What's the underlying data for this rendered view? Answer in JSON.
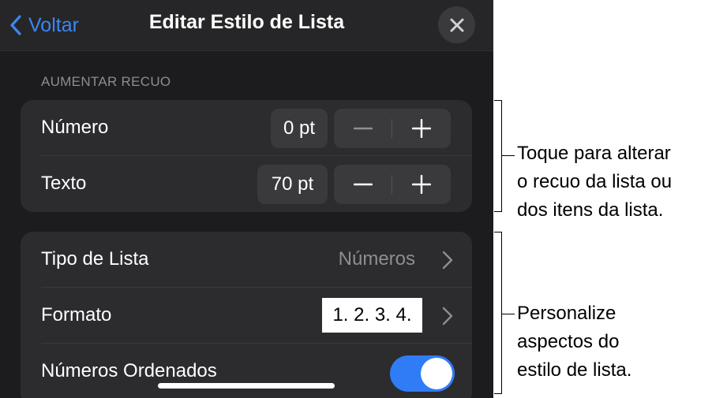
{
  "navbar": {
    "back_label": "Voltar",
    "title": "Editar Estilo de Lista"
  },
  "indent_section": {
    "header": "AUMENTAR RECUO",
    "rows": [
      {
        "label": "Número",
        "value": "0 pt"
      },
      {
        "label": "Texto",
        "value": "70 pt"
      }
    ]
  },
  "list_section": {
    "list_type": {
      "label": "Tipo de Lista",
      "value": "Números"
    },
    "format": {
      "label": "Formato",
      "value": "1. 2. 3. 4."
    },
    "ordered": {
      "label": "Números Ordenados",
      "on": true
    }
  },
  "annotations": {
    "indent": "Toque para alterar\no recuo da lista ou\ndos itens da lista.",
    "style": "Personalize\naspectos do\nestilo de lista."
  },
  "colors": {
    "accent": "#3a87f5",
    "toggle_on": "#2f7cf6",
    "panel_bg": "#1c1c1e",
    "group_bg": "#2c2c2e"
  }
}
